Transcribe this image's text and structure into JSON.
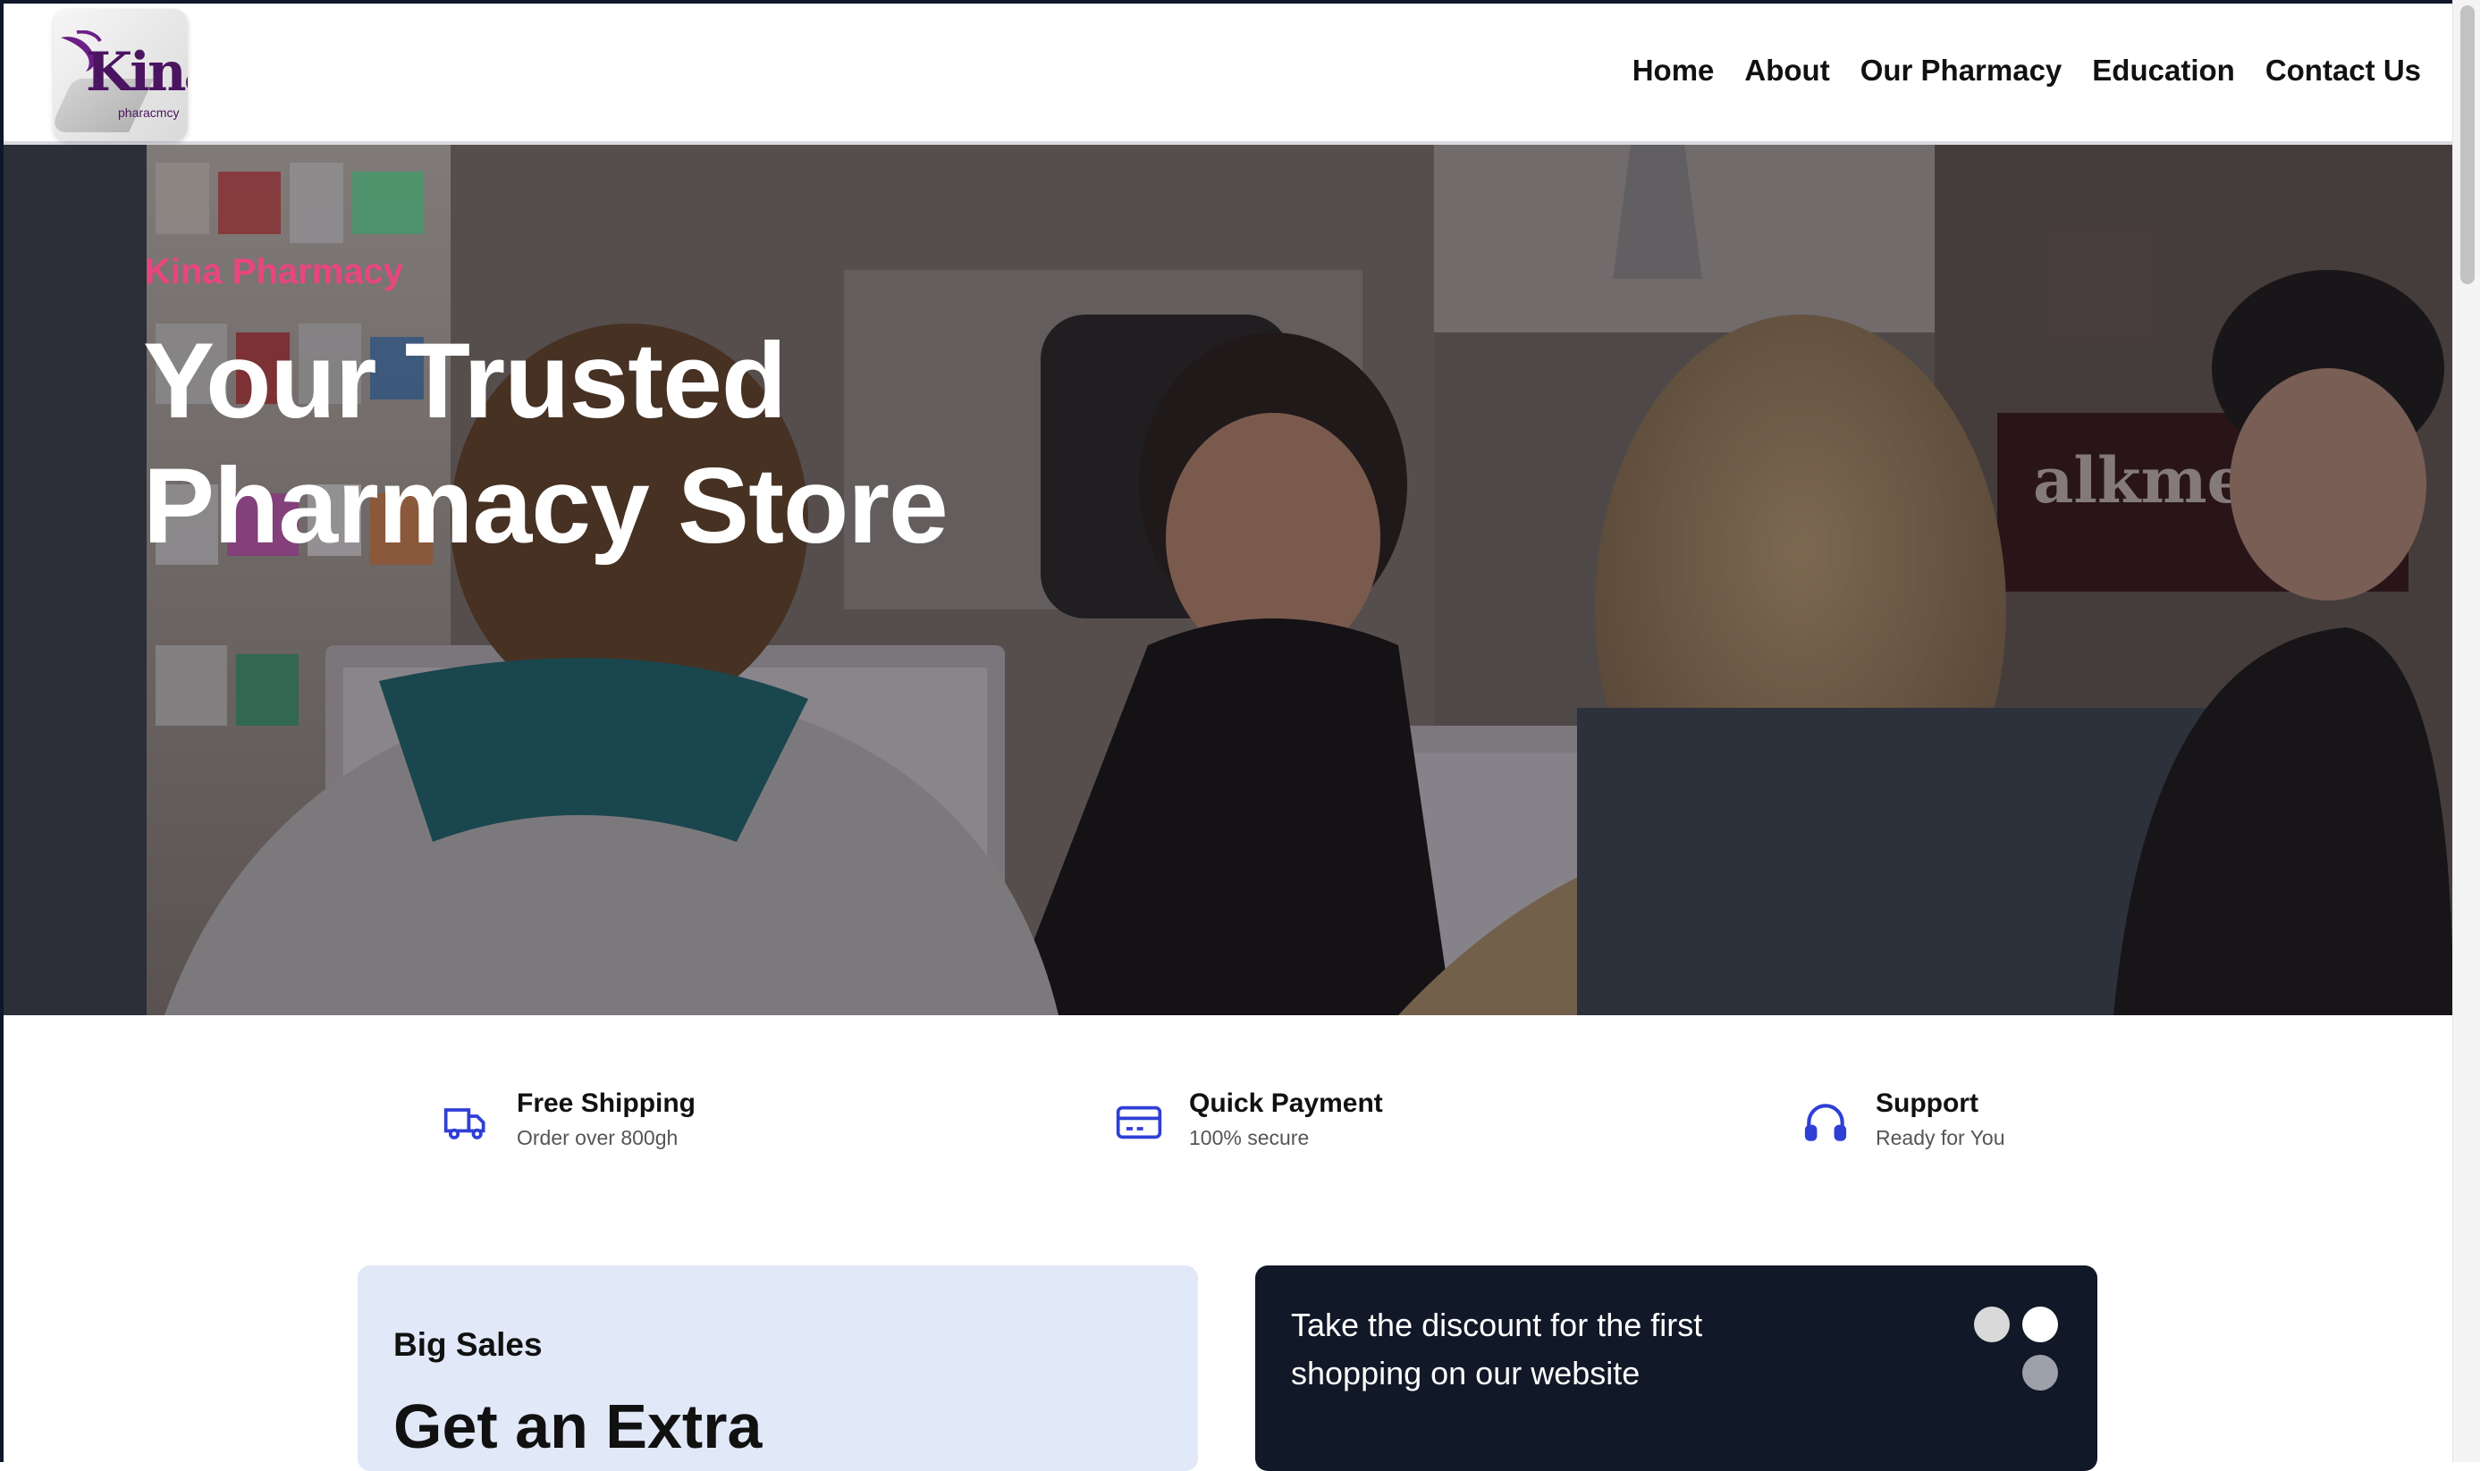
{
  "header": {
    "logo": {
      "word": "Kina",
      "sub": "pharacmcy"
    },
    "nav": [
      "Home",
      "About",
      "Our Pharmacy",
      "Education",
      "Contact Us"
    ]
  },
  "hero": {
    "kicker": "Kina Pharmacy",
    "title_line1": "Your Trusted",
    "title_line2": "Pharmacy Store"
  },
  "features": [
    {
      "icon": "truck-icon",
      "title": "Free Shipping",
      "subtitle": "Order over 800gh"
    },
    {
      "icon": "credit-card-icon",
      "title": "Quick Payment",
      "subtitle": "100% secure"
    },
    {
      "icon": "headphones-icon",
      "title": "Support",
      "subtitle": "Ready for You"
    }
  ],
  "promo": {
    "left": {
      "tag": "Big Sales",
      "headline": "Get an Extra"
    },
    "right": {
      "text": "Take the discount for the first shopping on our website"
    }
  },
  "colors": {
    "accent": "#e8467f",
    "icon_blue": "#2f3fd6",
    "dark_card": "#111827",
    "light_card": "#e1e8f8"
  }
}
